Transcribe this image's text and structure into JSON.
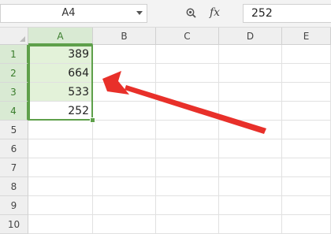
{
  "name_box": {
    "value": "A4"
  },
  "formula_bar": {
    "value": "252"
  },
  "columns": [
    "A",
    "B",
    "C",
    "D",
    "E"
  ],
  "rows": [
    "1",
    "2",
    "3",
    "4",
    "5",
    "6",
    "7",
    "8",
    "9",
    "10"
  ],
  "cells": {
    "A1": "389",
    "A2": "664",
    "A3": "533",
    "A4": "252"
  },
  "selection": {
    "range": "A1:A4",
    "active": "A4"
  },
  "colors": {
    "selection": "#5ea04a",
    "highlight": "#e3f2d9",
    "arrow": "#e8302a"
  },
  "icons": {
    "zoom": "zoom-icon",
    "fx": "fx-icon",
    "namebox_dropdown": "chevron-down-icon"
  }
}
